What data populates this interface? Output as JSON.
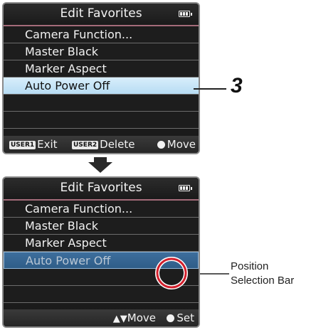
{
  "screen1": {
    "title": "Edit Favorites",
    "items": [
      "Camera Function...",
      "Master Black",
      "Marker Aspect",
      "Auto Power Off",
      "",
      "",
      ""
    ],
    "selected_index": 3,
    "footer": {
      "user1_badge": "USER1",
      "exit_label": "Exit",
      "user2_badge": "USER2",
      "delete_label": "Delete",
      "move_label": "Move"
    }
  },
  "screen2": {
    "title": "Edit Favorites",
    "items": [
      "Camera Function...",
      "Master Black",
      "Marker Aspect",
      "Auto Power Off",
      "",
      "",
      ""
    ],
    "selected_index": 3,
    "footer": {
      "move_glyphs": "▲▼",
      "move_label": "Move",
      "set_label": "Set"
    }
  },
  "callouts": {
    "step_number": "3",
    "position_bar_line1": "Position",
    "position_bar_line2": "Selection Bar"
  },
  "arrow": "down-arrow-icon",
  "colors": {
    "highlight": "#c8e6f8",
    "position_bar": "#3a6a98",
    "callout_circle": "#d21f2c"
  }
}
